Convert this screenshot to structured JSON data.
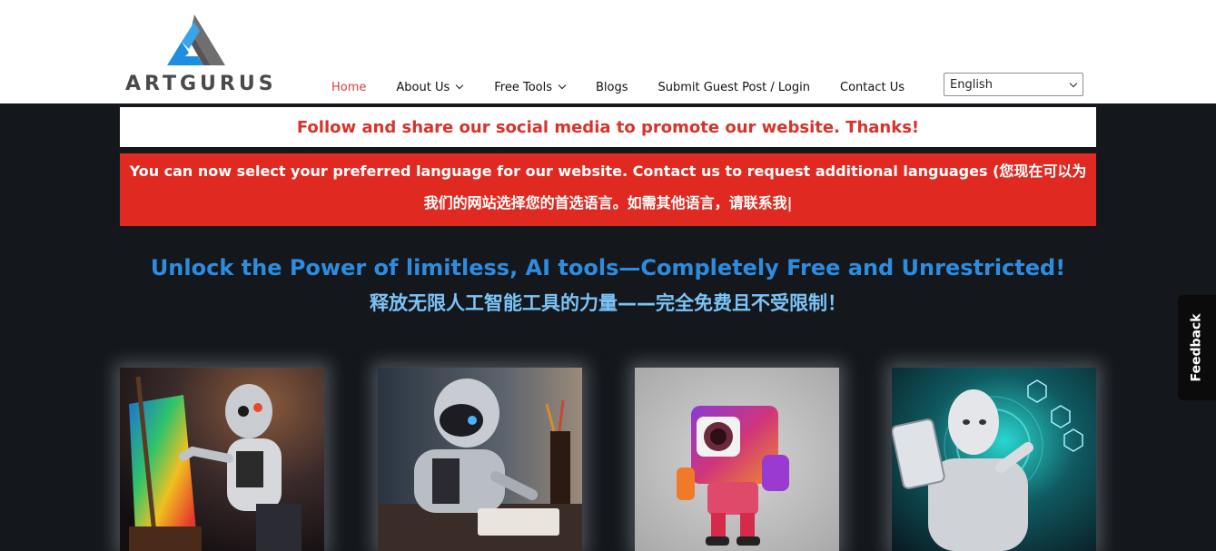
{
  "brand": {
    "name": "ARTGURUS"
  },
  "nav": {
    "items": [
      {
        "label": "Home",
        "has_dropdown": false,
        "active": true
      },
      {
        "label": "About Us",
        "has_dropdown": true,
        "active": false
      },
      {
        "label": "Free Tools",
        "has_dropdown": true,
        "active": false
      },
      {
        "label": "Blogs",
        "has_dropdown": false,
        "active": false
      },
      {
        "label": "Submit Guest Post / Login",
        "has_dropdown": false,
        "active": false
      },
      {
        "label": "Contact Us",
        "has_dropdown": false,
        "active": false
      }
    ]
  },
  "language_select": {
    "value": "English"
  },
  "banners": {
    "social": "Follow and share our social media to promote our website. Thanks!",
    "language": "You can now select your preferred language for our website. Contact us to request additional languages (您现在可以为我们的网站选择您的首选语言。如需其他语言，请联系我|"
  },
  "hero": {
    "title_en": "Unlock the Power of limitless, AI tools—Completely Free and Unrestricted!",
    "title_zh": "释放无限人工智能工具的力量——完全免费且不受限制！"
  },
  "cards": [
    {
      "image": "robot-painting-canvas"
    },
    {
      "image": "robot-at-desk"
    },
    {
      "image": "camera-head-robot"
    },
    {
      "image": "humanoid-with-tablet"
    }
  ],
  "feedback": {
    "label": "Feedback"
  },
  "colors": {
    "accent_red": "#e02a21",
    "nav_active": "#e03b3b",
    "hero_blue": "#2d8ce0",
    "hero_light_blue": "#7cc3f7",
    "page_bg": "#14181c"
  }
}
